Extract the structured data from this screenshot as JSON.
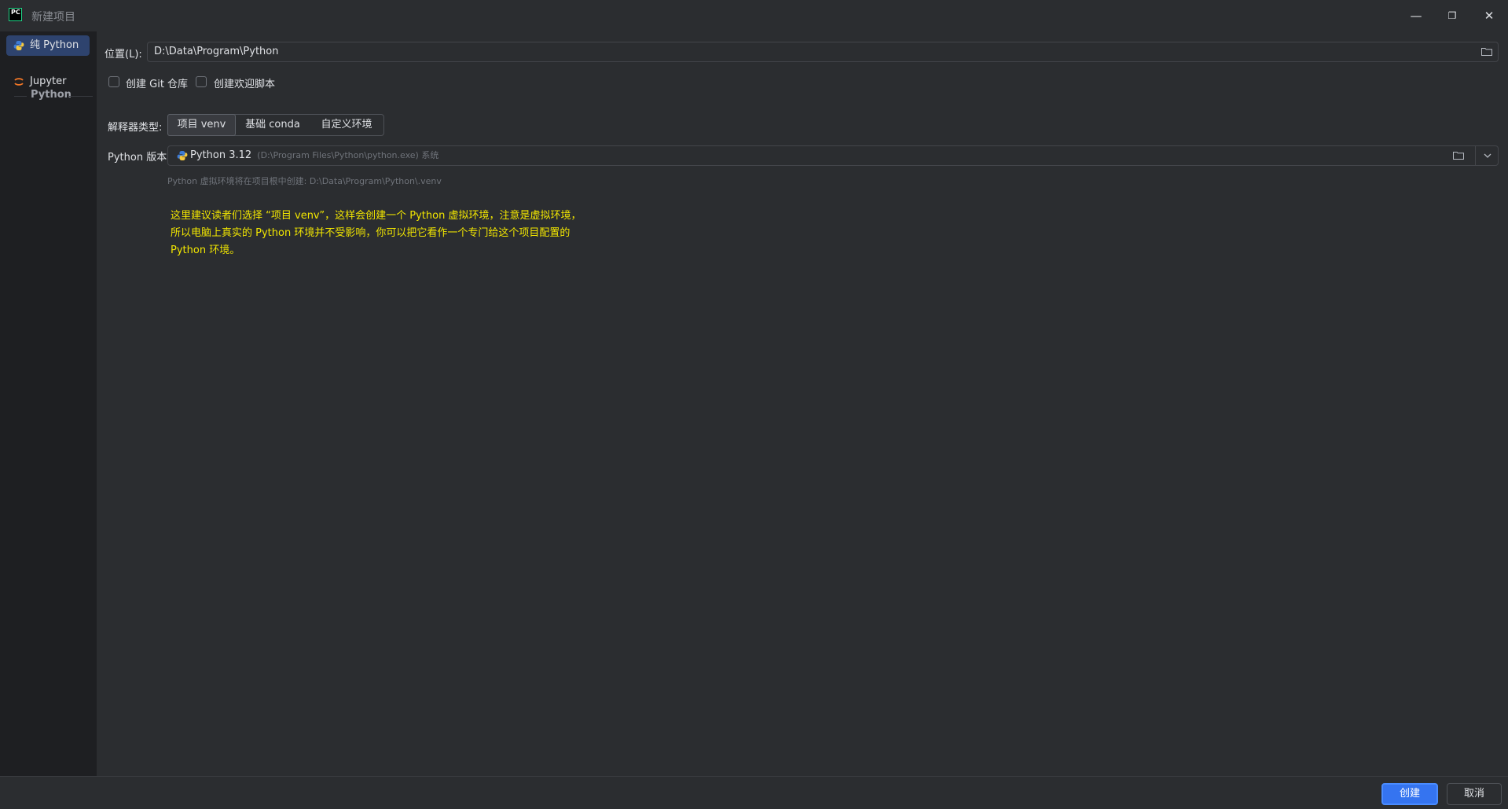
{
  "window": {
    "app_icon": "PC",
    "title": "新建项目",
    "controls": {
      "minimize": "—",
      "restore": "❐",
      "close": "✕"
    }
  },
  "sidebar": {
    "items": [
      {
        "label": "纯 Python",
        "icon": "python-icon",
        "active": true
      },
      {
        "label": "Jupyter",
        "icon": "jupyter-icon",
        "active": false
      }
    ],
    "group_label": "Python"
  },
  "form": {
    "location_label": "位置(L):",
    "location_value": "D:\\Data\\Program\\Python",
    "git_checkbox_label": "创建 Git 仓库",
    "welcome_checkbox_label": "创建欢迎脚本",
    "interpreter_type_label": "解释器类型:",
    "interpreter_types": [
      "项目 venv",
      "基础 conda",
      "自定义环境"
    ],
    "python_version_label": "Python 版本:",
    "python_version_value": "Python 3.12",
    "python_version_path": "(D:\\Program Files\\Python\\python.exe) 系统",
    "venv_hint": "Python 虚拟环境将在项目根中创建: D:\\Data\\Program\\Python\\.venv"
  },
  "annotation": {
    "lines": [
      "这里建议读者们选择 “项目 venv”，这样会创建一个 Python 虚拟环境，注意是虚拟环境，",
      "所以电脑上真实的 Python 环境并不受影响，你可以把它看作一个专门给这个项目配置的",
      "Python 环境。"
    ],
    "color": "#f2e600"
  },
  "footer": {
    "create_button": "创建",
    "cancel_button": "取消"
  },
  "colors": {
    "accent": "#3574f0",
    "sidebar_bg": "#1e1f22",
    "main_bg": "#2b2d30"
  }
}
